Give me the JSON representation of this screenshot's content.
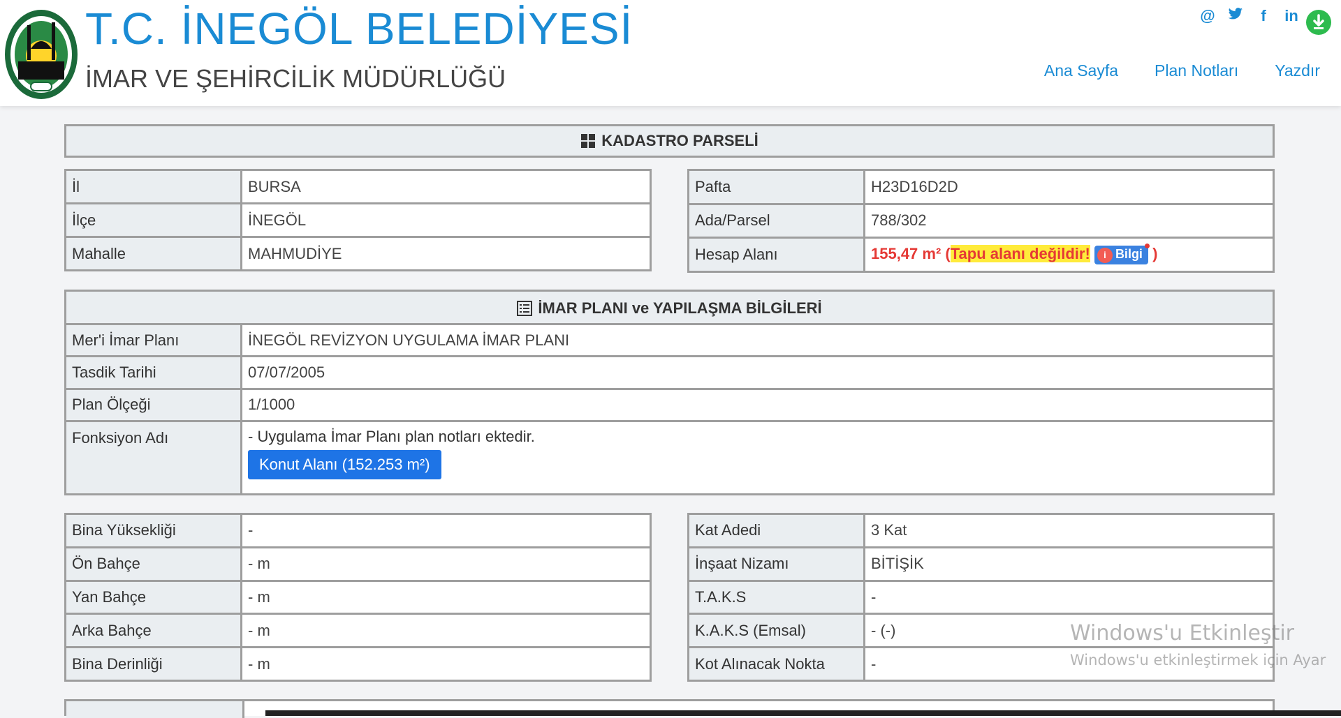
{
  "header": {
    "title": "T.C. İNEGÖL BELEDİYESİ",
    "subtitle": "İMAR VE ŞEHİRCİLİK MÜDÜRLÜĞÜ",
    "socials": [
      {
        "icon": "at-icon",
        "glyph": "@"
      },
      {
        "icon": "twitter-icon",
        "glyph": "🐦"
      },
      {
        "icon": "facebook-icon",
        "glyph": "f"
      },
      {
        "icon": "linkedin-icon",
        "glyph": "in"
      }
    ],
    "download_icon": "download-icon",
    "nav": [
      "Ana Sayfa",
      "Plan Notları",
      "Yazdır"
    ]
  },
  "kadastro": {
    "title": "KADASTRO PARSELİ",
    "left": [
      {
        "label": "İl",
        "value": "BURSA"
      },
      {
        "label": "İlçe",
        "value": "İNEGÖL"
      },
      {
        "label": "Mahalle",
        "value": "MAHMUDİYE"
      }
    ],
    "right": [
      {
        "label": "Pafta",
        "value": "H23D16D2D"
      },
      {
        "label": "Ada/Parsel",
        "value": "788/302"
      }
    ],
    "hesap": {
      "label": "Hesap Alanı",
      "area": "155,47 m²",
      "open": "(",
      "warning": "Tapu alanı değildir!",
      "bilgi": "Bilgi",
      "close": ")"
    }
  },
  "imar": {
    "title": "İMAR PLANI ve YAPILAŞMA BİLGİLERİ",
    "rows": [
      {
        "label": "Mer'i İmar Planı",
        "value": "İNEGÖL REVİZYON UYGULAMA İMAR PLANI"
      },
      {
        "label": "Tasdik Tarihi",
        "value": "07/07/2005"
      },
      {
        "label": "Plan Ölçeği",
        "value": "1/1000"
      }
    ],
    "fonksiyon": {
      "label": "Fonksiyon Adı",
      "note": "- Uygulama İmar Planı plan notları ektedir.",
      "button": "Konut Alanı (152.253 m²)"
    }
  },
  "yapi": {
    "left": [
      {
        "label": "Bina Yüksekliği",
        "value": "-"
      },
      {
        "label": "Ön Bahçe",
        "value": "- m"
      },
      {
        "label": "Yan Bahçe",
        "value": "- m"
      },
      {
        "label": "Arka Bahçe",
        "value": "- m"
      },
      {
        "label": "Bina Derinliği",
        "value": "- m"
      }
    ],
    "right": [
      {
        "label": "Kat Adedi",
        "value": "3 Kat"
      },
      {
        "label": "İnşaat Nizamı",
        "value": "BİTİŞİK"
      },
      {
        "label": "T.A.K.S",
        "value": "-"
      },
      {
        "label": "K.A.K.S (Emsal)",
        "value": "- (-)"
      },
      {
        "label": "Kot Alınacak Nokta",
        "value": "-"
      }
    ]
  },
  "watermark": {
    "line1": "Windows'u Etkinleştir",
    "line2": "Windows'u etkinleştirmek için Ayar"
  }
}
